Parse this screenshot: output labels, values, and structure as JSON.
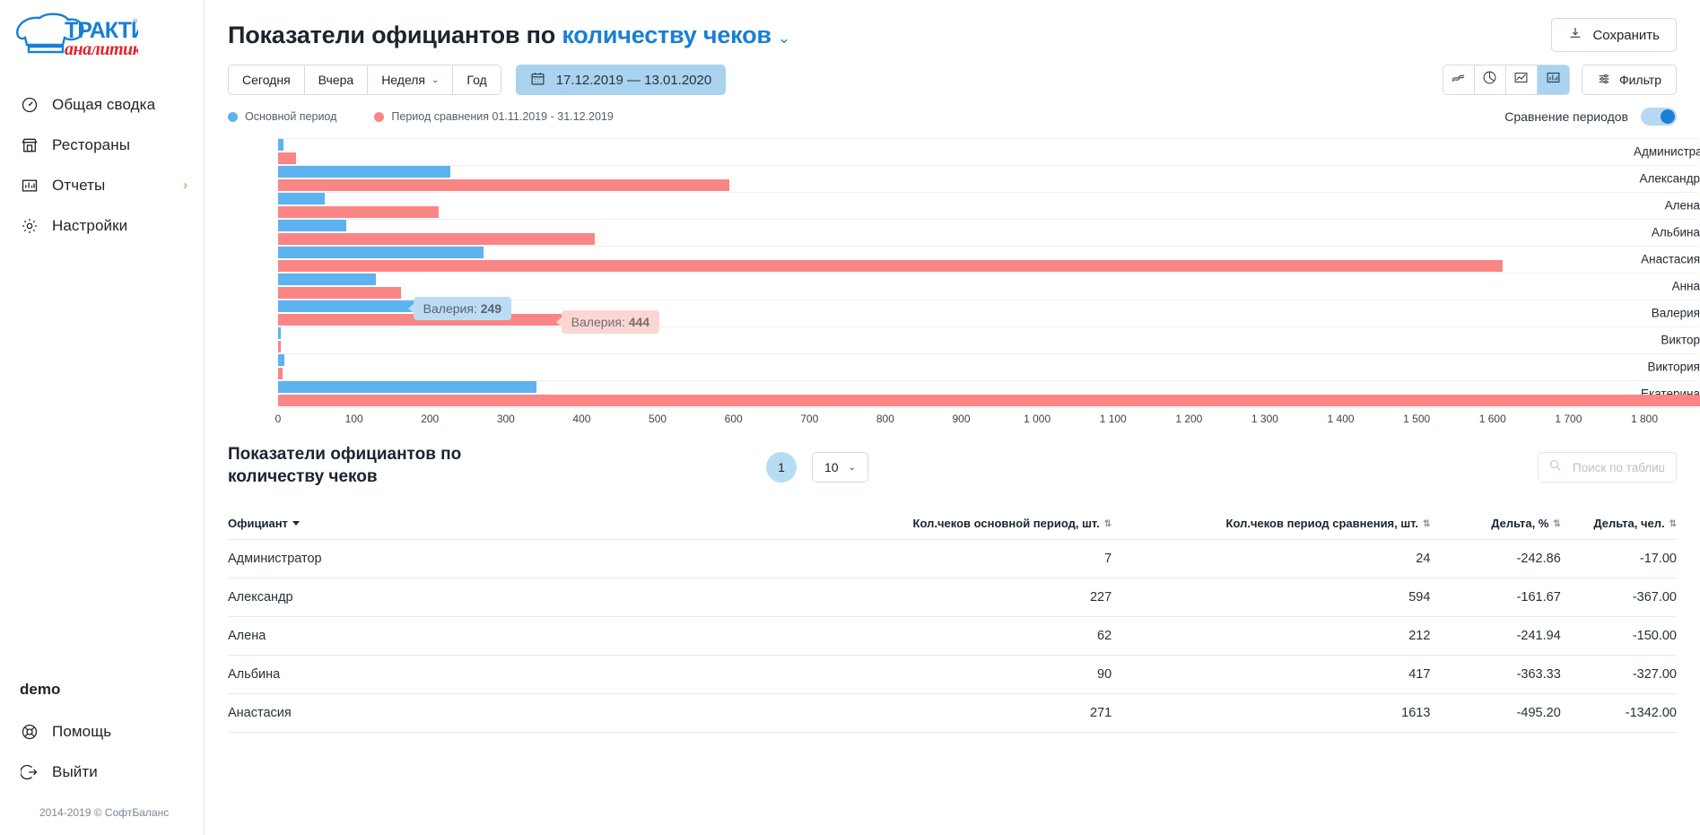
{
  "sidebar": {
    "logo_alt": "Трактиръ аналитика",
    "items": [
      {
        "label": "Общая сводка",
        "icon": "gauge-icon",
        "chevron": ""
      },
      {
        "label": "Рестораны",
        "icon": "store-icon",
        "chevron": ""
      },
      {
        "label": "Отчеты",
        "icon": "bar-chart-icon",
        "chevron": "›"
      },
      {
        "label": "Настройки",
        "icon": "gear-icon",
        "chevron": ""
      }
    ],
    "account": "demo",
    "bottom_items": [
      {
        "label": "Помощь",
        "icon": "lifebuoy-icon"
      },
      {
        "label": "Выйти",
        "icon": "logout-icon"
      }
    ],
    "copyright": "2014-2019 © СофтБаланс"
  },
  "header": {
    "title_plain": "Показатели официантов по ",
    "title_accent": "количеству чеков",
    "title_chevron": "⌄",
    "save_label": "Сохранить",
    "save_icon": "download-icon"
  },
  "toolbar": {
    "periods": [
      {
        "label": "Сегодня",
        "chevron": ""
      },
      {
        "label": "Вчера",
        "chevron": ""
      },
      {
        "label": "Неделя",
        "chevron": "⌄"
      },
      {
        "label": "Год",
        "chevron": ""
      }
    ],
    "date_range": "17.12.2019 — 13.01.2020",
    "calendar_icon": "calendar-icon",
    "chart_types": [
      {
        "icon": "line-chart-icon",
        "active": false
      },
      {
        "icon": "pie-chart-icon",
        "active": false
      },
      {
        "icon": "area-chart-icon",
        "active": false
      },
      {
        "icon": "bar-chart-icon",
        "active": true
      }
    ],
    "filter_label": "Фильтр",
    "filter_icon": "sliders-icon"
  },
  "legend": {
    "primary_label": "Основной период",
    "primary_color": "#5cb3ef",
    "compare_label": "Период сравнения 01.11.2019 - 31.12.2019",
    "compare_color": "#fa8585",
    "comparison_toggle_label": "Сравнение периодов",
    "comparison_toggle_on": true
  },
  "chart_data": {
    "type": "bar",
    "orientation": "horizontal",
    "title": "Показатели официантов по количеству чеков",
    "xlabel": "",
    "ylabel": "",
    "xlim": [
      0,
      1800
    ],
    "grid": true,
    "legend_position": "top-left",
    "categories": [
      "Администратор",
      "Александр",
      "Алена",
      "Альбина",
      "Анастасия",
      "Анна",
      "Валерия",
      "Виктор",
      "Виктория",
      "Екатерина"
    ],
    "xticks": [
      0,
      100,
      200,
      300,
      400,
      500,
      600,
      700,
      800,
      900,
      1000,
      1100,
      1200,
      1300,
      1400,
      1500,
      1600,
      1700,
      1800
    ],
    "xtick_labels": [
      "0",
      "100",
      "200",
      "300",
      "400",
      "500",
      "600",
      "700",
      "800",
      "900",
      "1 000",
      "1 100",
      "1 200",
      "1 300",
      "1 400",
      "1 500",
      "1 600",
      "1 700",
      "1 800"
    ],
    "series": [
      {
        "name": "Основной период",
        "color": "#5cb3ef",
        "values": [
          7,
          227,
          62,
          90,
          271,
          129,
          249,
          3,
          8,
          340
        ]
      },
      {
        "name": "Период сравнения 01.11.2019 - 31.12.2019",
        "color": "#fa8585",
        "values": [
          24,
          594,
          212,
          417,
          1613,
          162,
          444,
          4,
          6,
          1890
        ]
      }
    ],
    "annotations": [
      {
        "text_label": "Валерия",
        "text_value": "249",
        "series": "Основной период",
        "style": "blue"
      },
      {
        "text_label": "Валерия",
        "text_value": "444",
        "series": "Период сравнения",
        "style": "red"
      }
    ]
  },
  "table": {
    "title": "Показатели официантов по количеству чеков",
    "page_current": "1",
    "per_page": "10",
    "per_page_chevron": "⌄",
    "search_placeholder": "Поиск по таблице",
    "search_value": "",
    "search_icon": "search-icon",
    "columns": [
      {
        "label": "Официант",
        "sort": "caret",
        "align": "left"
      },
      {
        "label": "Кол.чеков основной период, шт.",
        "sort": "updown",
        "align": "right"
      },
      {
        "label": "Кол.чеков период сравнения, шт.",
        "sort": "updown",
        "align": "right"
      },
      {
        "label": "Дельта, %",
        "sort": "updown",
        "align": "right"
      },
      {
        "label": "Дельта, чел.",
        "sort": "updown",
        "align": "right"
      }
    ],
    "rows": [
      {
        "name": "Администратор",
        "main": "7",
        "compare": "24",
        "delta_pct": "-242.86",
        "delta_cnt": "-17.00"
      },
      {
        "name": "Александр",
        "main": "227",
        "compare": "594",
        "delta_pct": "-161.67",
        "delta_cnt": "-367.00"
      },
      {
        "name": "Алена",
        "main": "62",
        "compare": "212",
        "delta_pct": "-241.94",
        "delta_cnt": "-150.00"
      },
      {
        "name": "Альбина",
        "main": "90",
        "compare": "417",
        "delta_pct": "-363.33",
        "delta_cnt": "-327.00"
      },
      {
        "name": "Анастасия",
        "main": "271",
        "compare": "1613",
        "delta_pct": "-495.20",
        "delta_cnt": "-1342.00"
      }
    ]
  }
}
